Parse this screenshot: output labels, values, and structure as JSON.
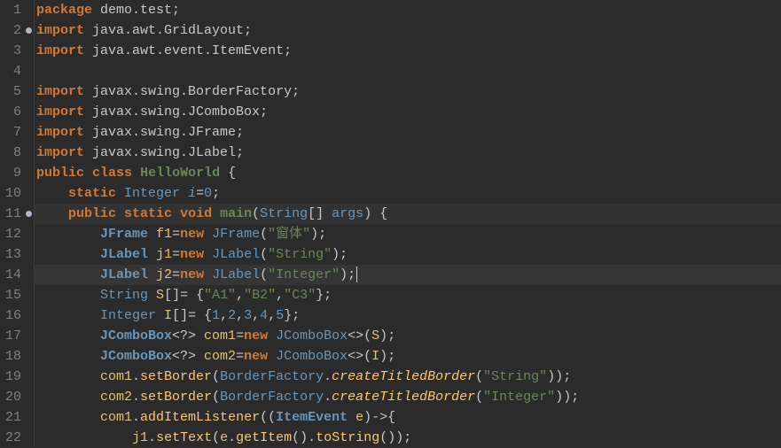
{
  "lines": [
    {
      "num": "1",
      "marker": false,
      "hl": false,
      "tokens": [
        {
          "c": "t-kw",
          "t": "package"
        },
        {
          "c": "t-sym",
          "t": " "
        },
        {
          "c": "t-ns",
          "t": "demo.test"
        },
        {
          "c": "t-sym",
          "t": ";"
        }
      ]
    },
    {
      "num": "2",
      "marker": true,
      "hl": false,
      "tokens": [
        {
          "c": "t-kw",
          "t": "import"
        },
        {
          "c": "t-sym",
          "t": " "
        },
        {
          "c": "t-ns",
          "t": "java.awt.GridLayout"
        },
        {
          "c": "t-sym",
          "t": ";"
        }
      ]
    },
    {
      "num": "3",
      "marker": false,
      "hl": false,
      "tokens": [
        {
          "c": "t-kw",
          "t": "import"
        },
        {
          "c": "t-sym",
          "t": " "
        },
        {
          "c": "t-ns",
          "t": "java.awt.event.ItemEvent"
        },
        {
          "c": "t-sym",
          "t": ";"
        }
      ]
    },
    {
      "num": "4",
      "marker": false,
      "hl": false,
      "tokens": []
    },
    {
      "num": "5",
      "marker": false,
      "hl": false,
      "tokens": [
        {
          "c": "t-kw",
          "t": "import"
        },
        {
          "c": "t-sym",
          "t": " "
        },
        {
          "c": "t-ns",
          "t": "javax.swing.BorderFactory"
        },
        {
          "c": "t-sym",
          "t": ";"
        }
      ]
    },
    {
      "num": "6",
      "marker": false,
      "hl": false,
      "tokens": [
        {
          "c": "t-kw",
          "t": "import"
        },
        {
          "c": "t-sym",
          "t": " "
        },
        {
          "c": "t-ns",
          "t": "javax.swing.JComboBox"
        },
        {
          "c": "t-sym",
          "t": ";"
        }
      ]
    },
    {
      "num": "7",
      "marker": false,
      "hl": false,
      "tokens": [
        {
          "c": "t-kw",
          "t": "import"
        },
        {
          "c": "t-sym",
          "t": " "
        },
        {
          "c": "t-ns",
          "t": "javax.swing.JFrame"
        },
        {
          "c": "t-sym",
          "t": ";"
        }
      ]
    },
    {
      "num": "8",
      "marker": false,
      "hl": false,
      "tokens": [
        {
          "c": "t-kw",
          "t": "import"
        },
        {
          "c": "t-sym",
          "t": " "
        },
        {
          "c": "t-ns",
          "t": "javax.swing.JLabel"
        },
        {
          "c": "t-sym",
          "t": ";"
        }
      ]
    },
    {
      "num": "9",
      "marker": false,
      "hl": false,
      "tokens": [
        {
          "c": "t-kw",
          "t": "public"
        },
        {
          "c": "t-sym",
          "t": " "
        },
        {
          "c": "t-kw",
          "t": "class"
        },
        {
          "c": "t-sym",
          "t": " "
        },
        {
          "c": "t-green",
          "t": "HelloWorld"
        },
        {
          "c": "t-sym",
          "t": " {"
        }
      ]
    },
    {
      "num": "10",
      "marker": false,
      "hl": false,
      "tokens": [
        {
          "c": "t-sym",
          "t": "    "
        },
        {
          "c": "t-kw",
          "t": "static"
        },
        {
          "c": "t-sym",
          "t": " "
        },
        {
          "c": "t-type",
          "t": "Integer"
        },
        {
          "c": "t-sym",
          "t": " "
        },
        {
          "c": "t-vari",
          "t": "i"
        },
        {
          "c": "t-sym",
          "t": "="
        },
        {
          "c": "t-num",
          "t": "0"
        },
        {
          "c": "t-sym",
          "t": ";"
        }
      ]
    },
    {
      "num": "11",
      "marker": true,
      "hl": true,
      "tokens": [
        {
          "c": "t-sym",
          "t": "    "
        },
        {
          "c": "t-kw",
          "t": "public"
        },
        {
          "c": "t-sym",
          "t": " "
        },
        {
          "c": "t-kw",
          "t": "static"
        },
        {
          "c": "t-sym",
          "t": " "
        },
        {
          "c": "t-kw",
          "t": "void"
        },
        {
          "c": "t-sym",
          "t": " "
        },
        {
          "c": "t-green",
          "t": "main"
        },
        {
          "c": "t-paren",
          "t": "("
        },
        {
          "c": "t-type",
          "t": "String"
        },
        {
          "c": "t-sym",
          "t": "[] "
        },
        {
          "c": "t-var",
          "t": "args"
        },
        {
          "c": "t-paren",
          "t": ")"
        },
        {
          "c": "t-sym",
          "t": " {"
        }
      ]
    },
    {
      "num": "12",
      "marker": false,
      "hl": false,
      "tokens": [
        {
          "c": "t-sym",
          "t": "        "
        },
        {
          "c": "t-typebold",
          "t": "JFrame"
        },
        {
          "c": "t-sym",
          "t": " "
        },
        {
          "c": "t-ident",
          "t": "f1"
        },
        {
          "c": "t-sym",
          "t": "="
        },
        {
          "c": "t-kw",
          "t": "new"
        },
        {
          "c": "t-sym",
          "t": " "
        },
        {
          "c": "t-type",
          "t": "JFrame"
        },
        {
          "c": "t-paren",
          "t": "("
        },
        {
          "c": "t-str",
          "t": "\"窗体\""
        },
        {
          "c": "t-paren",
          "t": ")"
        },
        {
          "c": "t-sym",
          "t": ";"
        }
      ]
    },
    {
      "num": "13",
      "marker": false,
      "hl": false,
      "tokens": [
        {
          "c": "t-sym",
          "t": "        "
        },
        {
          "c": "t-typebold",
          "t": "JLabel"
        },
        {
          "c": "t-sym",
          "t": " "
        },
        {
          "c": "t-ident",
          "t": "j1"
        },
        {
          "c": "t-sym",
          "t": "="
        },
        {
          "c": "t-kw",
          "t": "new"
        },
        {
          "c": "t-sym",
          "t": " "
        },
        {
          "c": "t-type",
          "t": "JLabel"
        },
        {
          "c": "t-paren",
          "t": "("
        },
        {
          "c": "t-str",
          "t": "\"String\""
        },
        {
          "c": "t-paren",
          "t": ")"
        },
        {
          "c": "t-sym",
          "t": ";"
        }
      ]
    },
    {
      "num": "14",
      "marker": false,
      "hl": false,
      "cursor": true,
      "tokens": [
        {
          "c": "t-sym",
          "t": "        "
        },
        {
          "c": "t-typebold",
          "t": "JLabel"
        },
        {
          "c": "t-sym",
          "t": " "
        },
        {
          "c": "t-ident",
          "t": "j2"
        },
        {
          "c": "t-sym",
          "t": "="
        },
        {
          "c": "t-kw",
          "t": "new"
        },
        {
          "c": "t-sym",
          "t": " "
        },
        {
          "c": "t-type",
          "t": "JLabel"
        },
        {
          "c": "t-paren",
          "t": "("
        },
        {
          "c": "t-str",
          "t": "\"Integer\""
        },
        {
          "c": "t-paren",
          "t": ")"
        },
        {
          "c": "t-sym",
          "t": ";"
        }
      ]
    },
    {
      "num": "15",
      "marker": false,
      "hl": false,
      "tokens": [
        {
          "c": "t-sym",
          "t": "        "
        },
        {
          "c": "t-type",
          "t": "String"
        },
        {
          "c": "t-sym",
          "t": " "
        },
        {
          "c": "t-ident",
          "t": "S"
        },
        {
          "c": "t-sym",
          "t": "[]= {"
        },
        {
          "c": "t-str",
          "t": "\"A1\""
        },
        {
          "c": "t-sym",
          "t": ","
        },
        {
          "c": "t-str",
          "t": "\"B2\""
        },
        {
          "c": "t-sym",
          "t": ","
        },
        {
          "c": "t-str",
          "t": "\"C3\""
        },
        {
          "c": "t-sym",
          "t": "};"
        }
      ]
    },
    {
      "num": "16",
      "marker": false,
      "hl": false,
      "tokens": [
        {
          "c": "t-sym",
          "t": "        "
        },
        {
          "c": "t-type",
          "t": "Integer"
        },
        {
          "c": "t-sym",
          "t": " "
        },
        {
          "c": "t-ident",
          "t": "I"
        },
        {
          "c": "t-sym",
          "t": "[]= {"
        },
        {
          "c": "t-num",
          "t": "1"
        },
        {
          "c": "t-sym",
          "t": ","
        },
        {
          "c": "t-num",
          "t": "2"
        },
        {
          "c": "t-sym",
          "t": ","
        },
        {
          "c": "t-num",
          "t": "3"
        },
        {
          "c": "t-sym",
          "t": ","
        },
        {
          "c": "t-num",
          "t": "4"
        },
        {
          "c": "t-sym",
          "t": ","
        },
        {
          "c": "t-num",
          "t": "5"
        },
        {
          "c": "t-sym",
          "t": "};"
        }
      ]
    },
    {
      "num": "17",
      "marker": false,
      "hl": false,
      "tokens": [
        {
          "c": "t-sym",
          "t": "        "
        },
        {
          "c": "t-typebold",
          "t": "JComboBox"
        },
        {
          "c": "t-sym",
          "t": "<?> "
        },
        {
          "c": "t-ident",
          "t": "com1"
        },
        {
          "c": "t-sym",
          "t": "="
        },
        {
          "c": "t-kw",
          "t": "new"
        },
        {
          "c": "t-sym",
          "t": " "
        },
        {
          "c": "t-type",
          "t": "JComboBox"
        },
        {
          "c": "t-sym",
          "t": "<>"
        },
        {
          "c": "t-paren",
          "t": "("
        },
        {
          "c": "t-ident",
          "t": "S"
        },
        {
          "c": "t-paren",
          "t": ")"
        },
        {
          "c": "t-sym",
          "t": ";"
        }
      ]
    },
    {
      "num": "18",
      "marker": false,
      "hl": false,
      "tokens": [
        {
          "c": "t-sym",
          "t": "        "
        },
        {
          "c": "t-typebold",
          "t": "JComboBox"
        },
        {
          "c": "t-sym",
          "t": "<?> "
        },
        {
          "c": "t-ident",
          "t": "com2"
        },
        {
          "c": "t-sym",
          "t": "="
        },
        {
          "c": "t-kw",
          "t": "new"
        },
        {
          "c": "t-sym",
          "t": " "
        },
        {
          "c": "t-type",
          "t": "JComboBox"
        },
        {
          "c": "t-sym",
          "t": "<>"
        },
        {
          "c": "t-paren",
          "t": "("
        },
        {
          "c": "t-ident",
          "t": "I"
        },
        {
          "c": "t-paren",
          "t": ")"
        },
        {
          "c": "t-sym",
          "t": ";"
        }
      ]
    },
    {
      "num": "19",
      "marker": false,
      "hl": false,
      "tokens": [
        {
          "c": "t-sym",
          "t": "        "
        },
        {
          "c": "t-ident",
          "t": "com1"
        },
        {
          "c": "t-sym",
          "t": "."
        },
        {
          "c": "t-meth",
          "t": "setBorder"
        },
        {
          "c": "t-paren",
          "t": "("
        },
        {
          "c": "t-type",
          "t": "BorderFactory"
        },
        {
          "c": "t-sym",
          "t": "."
        },
        {
          "c": "t-methi",
          "t": "createTitledBorder"
        },
        {
          "c": "t-paren",
          "t": "("
        },
        {
          "c": "t-str",
          "t": "\"String\""
        },
        {
          "c": "t-paren",
          "t": ")"
        },
        {
          "c": "t-paren",
          "t": ")"
        },
        {
          "c": "t-sym",
          "t": ";"
        }
      ]
    },
    {
      "num": "20",
      "marker": false,
      "hl": false,
      "tokens": [
        {
          "c": "t-sym",
          "t": "        "
        },
        {
          "c": "t-ident",
          "t": "com2"
        },
        {
          "c": "t-sym",
          "t": "."
        },
        {
          "c": "t-meth",
          "t": "setBorder"
        },
        {
          "c": "t-paren",
          "t": "("
        },
        {
          "c": "t-type",
          "t": "BorderFactory"
        },
        {
          "c": "t-sym",
          "t": "."
        },
        {
          "c": "t-methi",
          "t": "createTitledBorder"
        },
        {
          "c": "t-paren",
          "t": "("
        },
        {
          "c": "t-str",
          "t": "\"Integer\""
        },
        {
          "c": "t-paren",
          "t": ")"
        },
        {
          "c": "t-paren",
          "t": ")"
        },
        {
          "c": "t-sym",
          "t": ";"
        }
      ]
    },
    {
      "num": "21",
      "marker": false,
      "hl": false,
      "tokens": [
        {
          "c": "t-sym",
          "t": "        "
        },
        {
          "c": "t-ident",
          "t": "com1"
        },
        {
          "c": "t-sym",
          "t": "."
        },
        {
          "c": "t-meth",
          "t": "addItemListener"
        },
        {
          "c": "t-paren",
          "t": "("
        },
        {
          "c": "t-paren",
          "t": "("
        },
        {
          "c": "t-typebold",
          "t": "ItemEvent"
        },
        {
          "c": "t-sym",
          "t": " "
        },
        {
          "c": "t-ident",
          "t": "e"
        },
        {
          "c": "t-paren",
          "t": ")"
        },
        {
          "c": "t-sym",
          "t": "->{"
        }
      ]
    },
    {
      "num": "22",
      "marker": false,
      "hl": false,
      "tokens": [
        {
          "c": "t-sym",
          "t": "            "
        },
        {
          "c": "t-ident",
          "t": "j1"
        },
        {
          "c": "t-sym",
          "t": "."
        },
        {
          "c": "t-meth",
          "t": "setText"
        },
        {
          "c": "t-paren",
          "t": "("
        },
        {
          "c": "t-ident",
          "t": "e"
        },
        {
          "c": "t-sym",
          "t": "."
        },
        {
          "c": "t-meth",
          "t": "getItem"
        },
        {
          "c": "t-paren",
          "t": "("
        },
        {
          "c": "t-paren",
          "t": ")"
        },
        {
          "c": "t-sym",
          "t": "."
        },
        {
          "c": "t-meth",
          "t": "toString"
        },
        {
          "c": "t-paren",
          "t": "("
        },
        {
          "c": "t-paren",
          "t": ")"
        },
        {
          "c": "t-paren",
          "t": ")"
        },
        {
          "c": "t-sym",
          "t": ";"
        }
      ]
    }
  ]
}
